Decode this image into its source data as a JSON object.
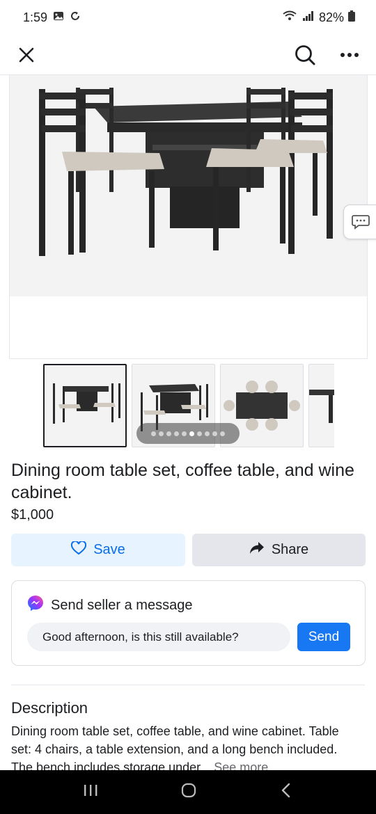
{
  "status": {
    "time": "1:59",
    "battery": "82%",
    "icons": [
      "gallery-icon",
      "sync-icon",
      "wifi-calling-icon",
      "signal-icon",
      "battery-icon"
    ]
  },
  "toolbar": {
    "close_icon": "close-icon",
    "search_icon": "search-icon",
    "more_icon": "more-icon"
  },
  "gallery": {
    "photo_count": 10,
    "current_index": 5,
    "thumbnails": [
      "dining-set-view-1",
      "dining-set-view-2",
      "dining-set-top-view",
      "dining-set-view-4"
    ],
    "side_button_icon": "chat-bubble-icon"
  },
  "listing": {
    "title": "Dining room table set, coffee table, and wine cabinet.",
    "price": "$1,000"
  },
  "actions": {
    "save_label": "Save",
    "share_label": "Share",
    "save_icon": "heart-icon",
    "share_icon": "share-arrow-icon"
  },
  "message": {
    "heading": "Send seller a message",
    "input_value": "Good afternoon, is this still available?",
    "send_label": "Send",
    "icon": "messenger-icon"
  },
  "description": {
    "heading": "Description",
    "text": "Dining room table set, coffee table, and wine cabinet. Table set: 4 chairs, a table extension, and a long bench included. The bench includes storage under...",
    "see_more": "See more"
  },
  "colors": {
    "accent": "#1877f2",
    "save_bg": "#e7f3ff",
    "save_text": "#0a6ee8",
    "share_bg": "#e4e6eb"
  }
}
